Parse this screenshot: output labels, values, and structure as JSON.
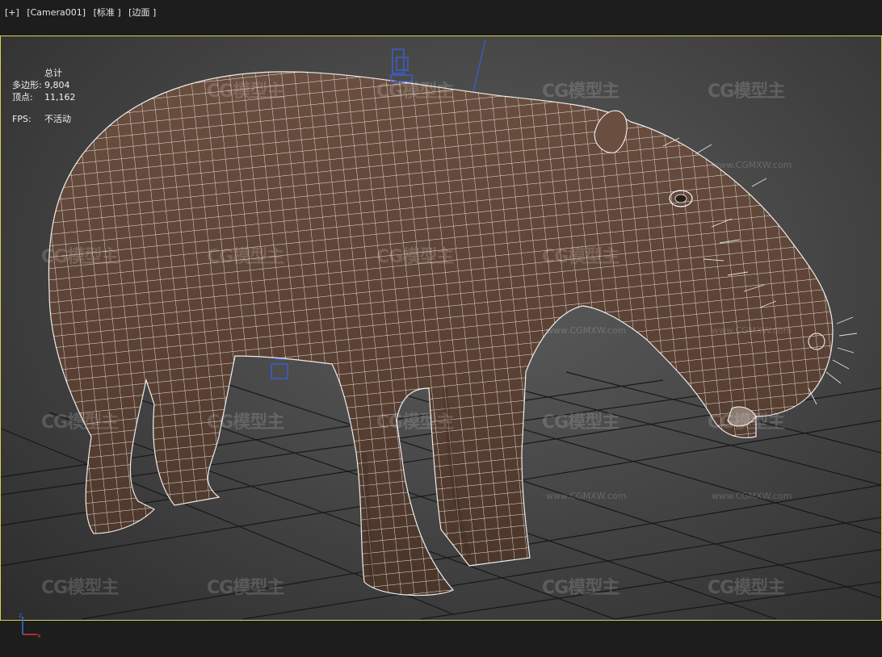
{
  "viewport_label": {
    "plus": "[+]",
    "camera": "[Camera001]",
    "shading": "[标准 ]",
    "edges": "[边面 ]"
  },
  "stats": {
    "title": "总计",
    "polygons_label": "多边形:",
    "polygons_value": "9,804",
    "vertices_label": "顶点:",
    "vertices_value": "11,162",
    "fps_label": "FPS:",
    "fps_value": "不活动"
  },
  "watermark": {
    "brand": "CG模型主",
    "url": "www.CGMXW.com"
  },
  "axis": {
    "x_label": "x",
    "z_label": "z"
  },
  "colors": {
    "viewport_border": "#d8d24a",
    "model_fill": "#5e4538",
    "wireframe": "#ffffff",
    "grid": "#111111",
    "camera_target": "#3a5fd6",
    "x_axis": "#d63a3a",
    "z_axis": "#3a6ad6"
  }
}
